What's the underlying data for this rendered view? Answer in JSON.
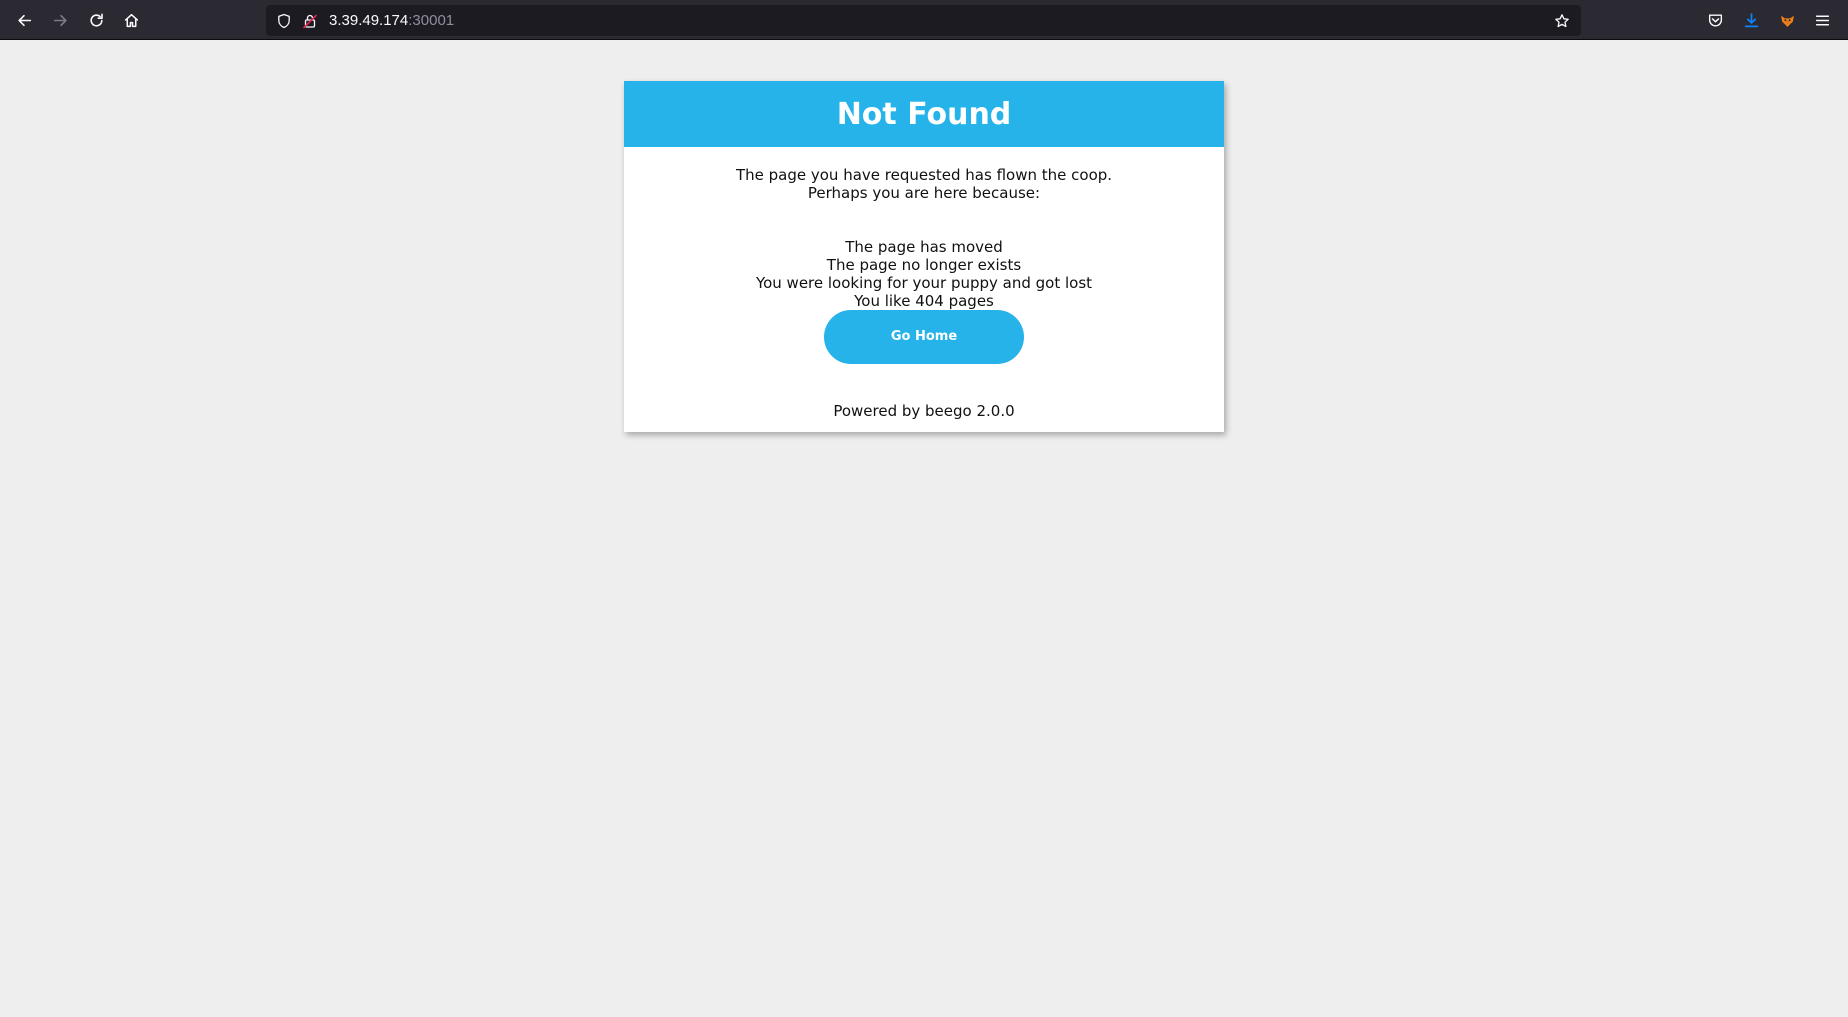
{
  "browser": {
    "url_host": "3.39.49.174",
    "url_port": ":30001",
    "icons": {
      "back": "back-arrow-icon",
      "forward": "forward-arrow-icon",
      "reload": "reload-icon",
      "home": "home-icon",
      "tracking": "shield-icon",
      "insecure": "insecure-lock-icon",
      "bookmark": "star-icon",
      "pocket": "pocket-icon",
      "downloads": "download-icon",
      "extension": "extension-fox-icon",
      "menu": "hamburger-menu-icon"
    },
    "colors": {
      "toolbar": "#2b2a33",
      "urlbar": "#1c1b22",
      "download_accent": "#0a84ff",
      "insecure_accent": "#e22850"
    }
  },
  "page": {
    "title": "Not Found",
    "intro_line1": "The page you have requested has flown the coop.",
    "intro_line2": "Perhaps you are here because:",
    "reasons": [
      "The page has moved",
      "The page no longer exists",
      "You were looking for your puppy and got lost",
      "You like 404 pages"
    ],
    "button_label": "Go Home",
    "footer": "Powered by beego 2.0.0",
    "colors": {
      "background": "#eeeeee",
      "accent": "#26b3e9",
      "card": "#ffffff"
    }
  }
}
